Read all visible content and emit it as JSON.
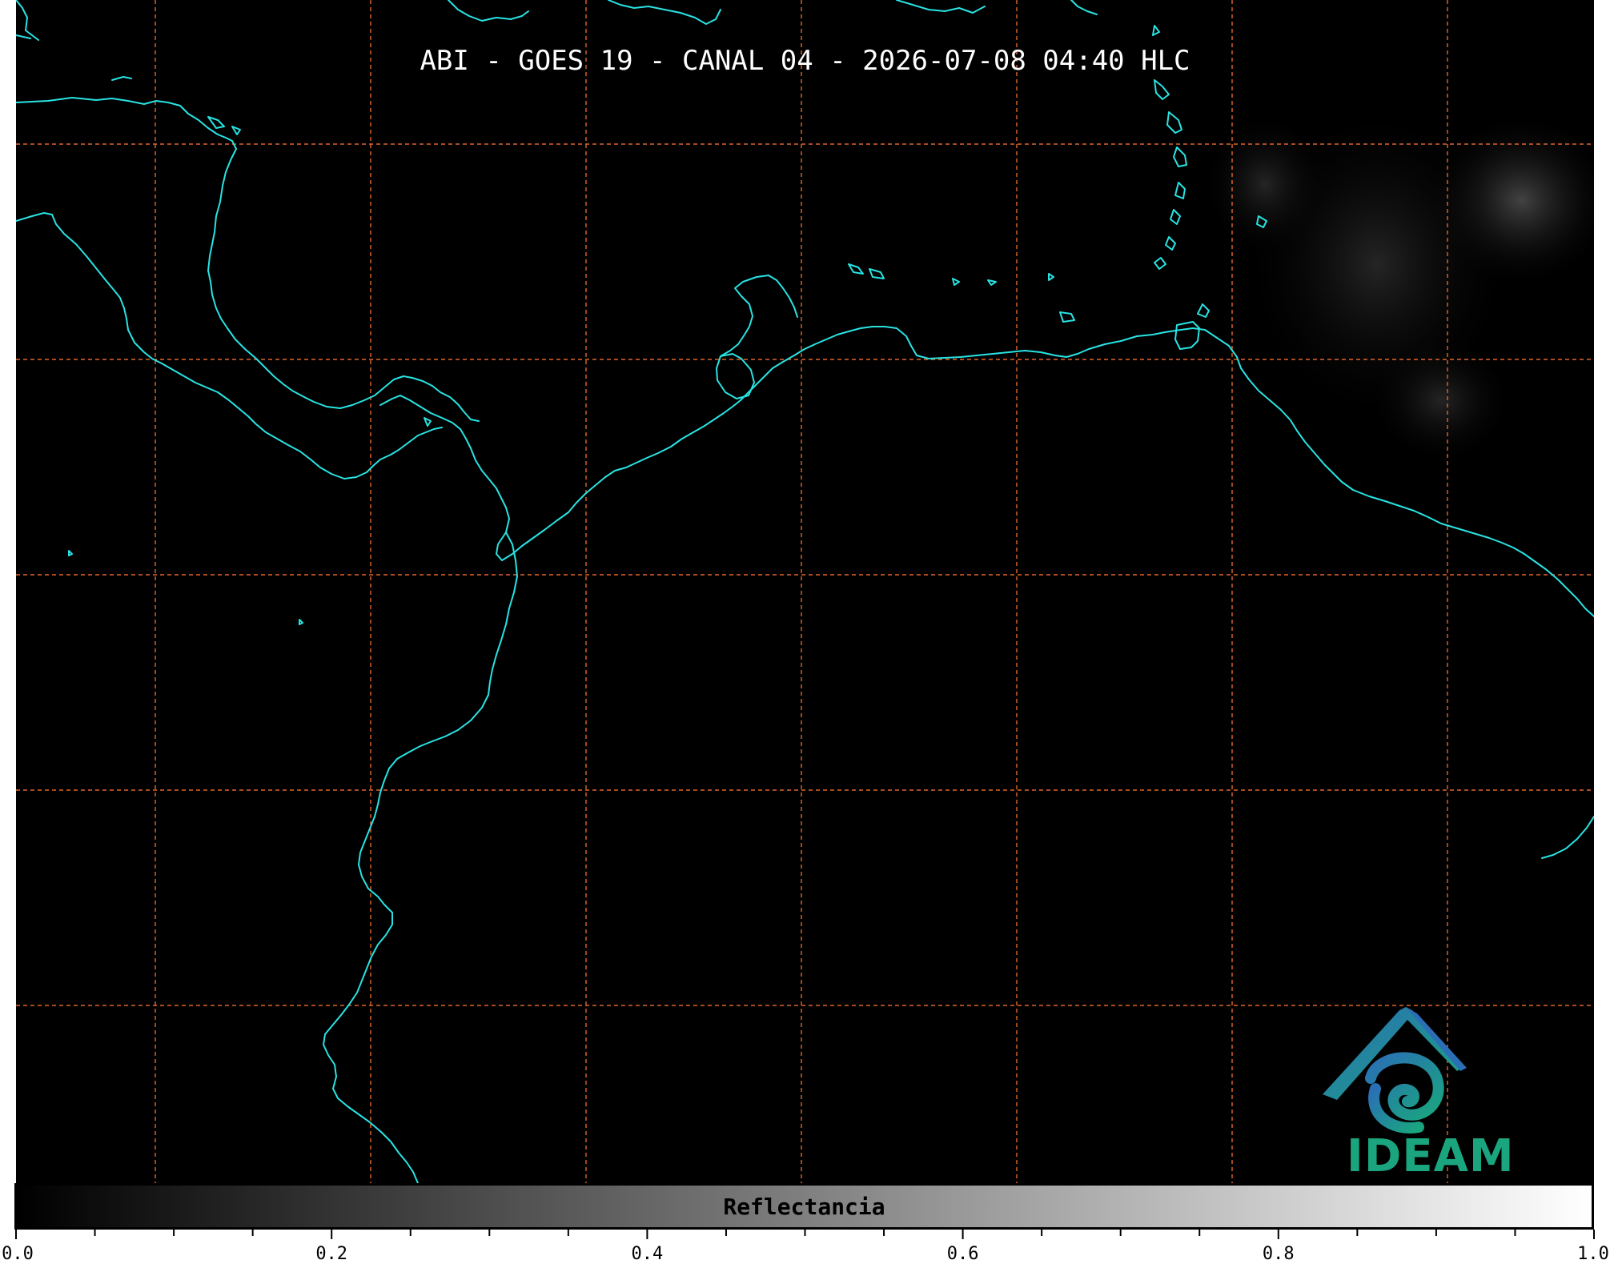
{
  "title": "ABI - GOES 19 - CANAL 04 - 2026-07-08 04:40 HLC",
  "colorbar": {
    "label": "Reflectancia",
    "min": 0.0,
    "max": 1.0,
    "colormap": "grayscale (black to white)",
    "major_ticks": [
      "0.0",
      "0.2",
      "0.4",
      "0.6",
      "0.8",
      "1.0"
    ],
    "minor_tick_step": 0.05
  },
  "map": {
    "background": "#000000",
    "coastline_color": "#29e3e3",
    "gridline_color": "#e0662a",
    "gridline_style": "dashed"
  },
  "logo": {
    "text": "IDEAM",
    "text_color": "#1aa57f",
    "mark_colors": [
      "#2a6fb5",
      "#1aa57f"
    ]
  }
}
